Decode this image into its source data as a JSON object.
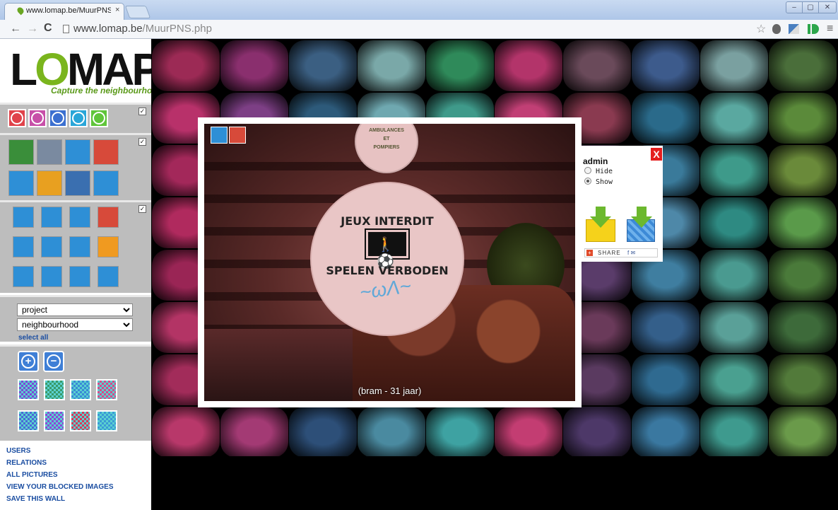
{
  "browser": {
    "tab_title": "www.lomap.be/MuurPNS.ph",
    "tab_close": "×",
    "url_host": "www.lomap.be",
    "url_path": "/MuurPNS.php",
    "win_min": "–",
    "win_max": "▢",
    "win_close": "✕",
    "back": "←",
    "forward": "→",
    "reload": "C",
    "star": "☆",
    "menu": "≡"
  },
  "logo": {
    "text_l": "L",
    "text_o": "O",
    "text_rest": "MAP",
    "tagline": "Capture the neighbourhood"
  },
  "filters": {
    "checkmark": "✓",
    "mood_colors": [
      "#e0424a",
      "#c74fa8",
      "#3b6fd0",
      "#2aa6d8",
      "#5fc53a"
    ],
    "project_value": "project",
    "neighbourhood_value": "neighbourhood",
    "dropdown_arrow": "▼",
    "select_all": "select all"
  },
  "zoom": {
    "plus": "+",
    "minus": "−"
  },
  "nav_links": [
    "USERS",
    "RELATIONS",
    "ALL PICTURES",
    "VIEW YOUR BLOCKED IMAGES",
    "SAVE THIS WALL"
  ],
  "photo": {
    "sign_top": "AMBULANCES\nET\nPOMPIERS",
    "sign_line1": "JEUX INTERDIT",
    "sign_line2": "SPELEN VERBODEN",
    "caption": "(bram - 31 jaar)"
  },
  "admin": {
    "close": "X",
    "title": "admin",
    "hide_label": "Hide",
    "show_label": "Show",
    "share_plus": "+",
    "share_label": "SHARE",
    "share_icons": "f ✉"
  },
  "wall_colors": [
    [
      "#9c2a55",
      "#8a2f6e",
      "#3b5f82",
      "#7aa8a8",
      "#2f8a5a",
      "#b3346a",
      "#6a4a5a",
      "#3d5b8c",
      "#7aa0a0",
      "#4a6e3a"
    ],
    [
      "#b8316a",
      "#7d3f85",
      "#2d5a7a",
      "#6fa8b0",
      "#3f9a8a",
      "#c13f75",
      "#8a3a50",
      "#2a6a8a",
      "#5aa8a0",
      "#5b8a3a"
    ],
    [
      "#a3285a",
      "#a2386f",
      "#2c4f7a",
      "#4e8ea4",
      "#2aa2a0",
      "#b12d62",
      "#5c3d6a",
      "#3a7a9a",
      "#3e9a8a",
      "#6a8a3a"
    ],
    [
      "#b02a5e",
      "#8a2f70",
      "#356892",
      "#3f8faa",
      "#5ab0a8",
      "#c23a6f",
      "#4a3a72",
      "#4e88a8",
      "#2e8a82",
      "#5a9a4a"
    ],
    [
      "#9a2555",
      "#9a3a78",
      "#2f6a8e",
      "#6aa6b8",
      "#3aa0a0",
      "#a82a5c",
      "#5a3c6a",
      "#3f7ea0",
      "#4a9a90",
      "#4a7a3a"
    ],
    [
      "#b33465",
      "#7a356e",
      "#3a5f88",
      "#4f9ab0",
      "#2f9aa0",
      "#bd3b6e",
      "#6a3a5a",
      "#345f8a",
      "#5aa098",
      "#3d6a3a"
    ],
    [
      "#a22c5a",
      "#8a3a72",
      "#2d5a84",
      "#5aa4b2",
      "#3a8e98",
      "#b0346a",
      "#5a3a60",
      "#2f6a90",
      "#4aa090",
      "#527a3a"
    ],
    [
      "#b8386a",
      "#a33a74",
      "#2d4f78",
      "#4a8aa0",
      "#3ea2a2",
      "#c33d72",
      "#4d3868",
      "#3a78a0",
      "#3e9a8e",
      "#6a9a4a"
    ]
  ],
  "theme_colors": [
    "#3a8e3a",
    "#7a8aa0",
    "#2e8fd6",
    "#d74a3a",
    "#2e8fd6",
    "#e8a020",
    "#3a6fb0",
    "#2e8fd6",
    "#f0c020",
    "#2e8fd6",
    "#2e8fd6",
    "#333333"
  ],
  "sense_colors": [
    "#2e8fd6",
    "#2e8fd6",
    "#2e8fd6",
    "#d74a3a",
    "#2e8fd6",
    "#2e8fd6",
    "#2e8fd6",
    "#f09a20",
    "#2e8fd6",
    "#2e8fd6",
    "#2e8fd6",
    "#2e8fd6"
  ],
  "grid_colors": [
    "#7a4ad6",
    "#3a9a6a",
    "#3a8ad6",
    "#d64a8a",
    "#4a6ad6",
    "#8a4ad6",
    "#d63a5a",
    "#3a9ad6"
  ]
}
